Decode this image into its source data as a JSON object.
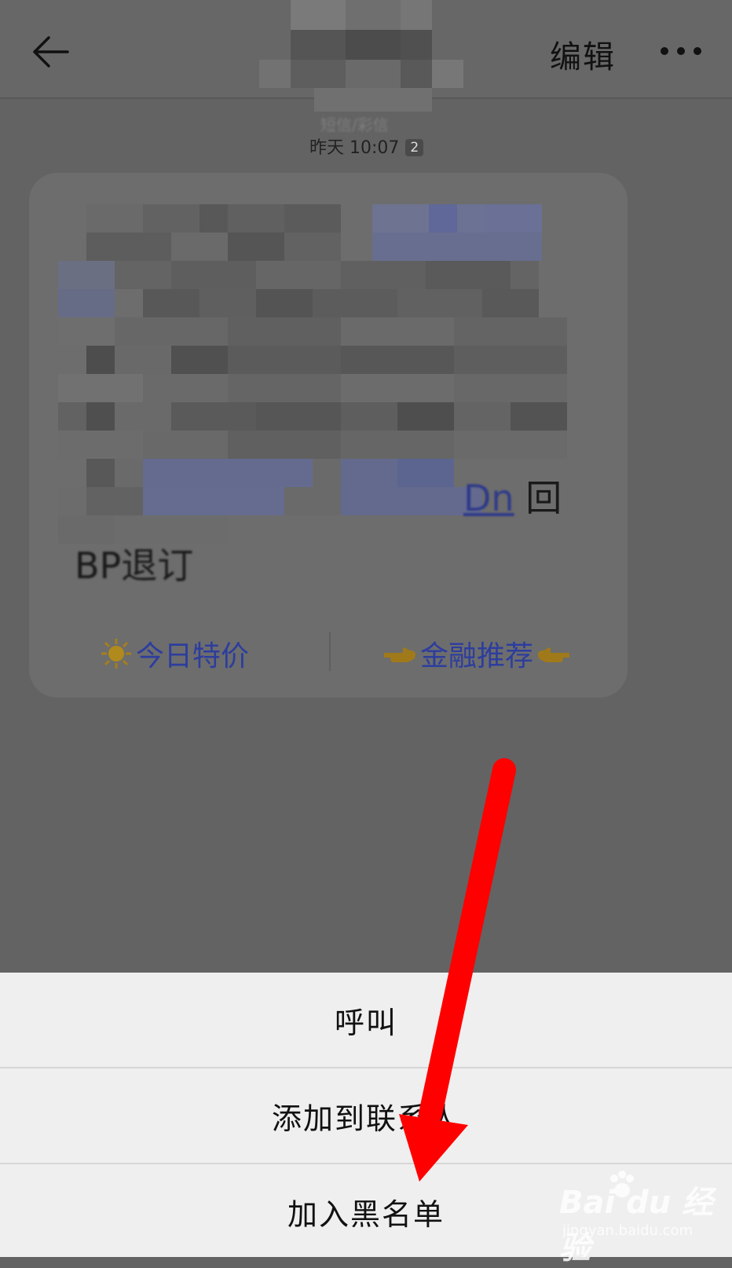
{
  "header": {
    "back_icon": "arrow-left-icon",
    "edit_label": "编辑",
    "more_icon": "more-horizontal-icon",
    "title_redacted": true,
    "subtitle": "短信/彩信",
    "timestamp": "昨天 10:07",
    "sim_badge": "2"
  },
  "message": {
    "body_redacted": true,
    "tail_right": "回",
    "tail_link": "Dn",
    "tail_text": "BP退订",
    "quick_replies": [
      {
        "icon": "sun-icon",
        "label": "今日特价"
      },
      {
        "icon": "pointing-hand-icon",
        "label": "金融推荐"
      }
    ]
  },
  "action_sheet": {
    "items": [
      {
        "label": "呼叫"
      },
      {
        "label": "添加到联系人"
      },
      {
        "label": "加入黑名单"
      }
    ]
  },
  "overlay": {
    "arrow_color": "#ff0000"
  },
  "watermark": {
    "logo": "Bai du 经验",
    "url": "jingyan.baidu.com"
  },
  "colors": {
    "dim_background": "#636363",
    "sheet_background": "#efefef",
    "link_blue": "#2d3d9e"
  }
}
